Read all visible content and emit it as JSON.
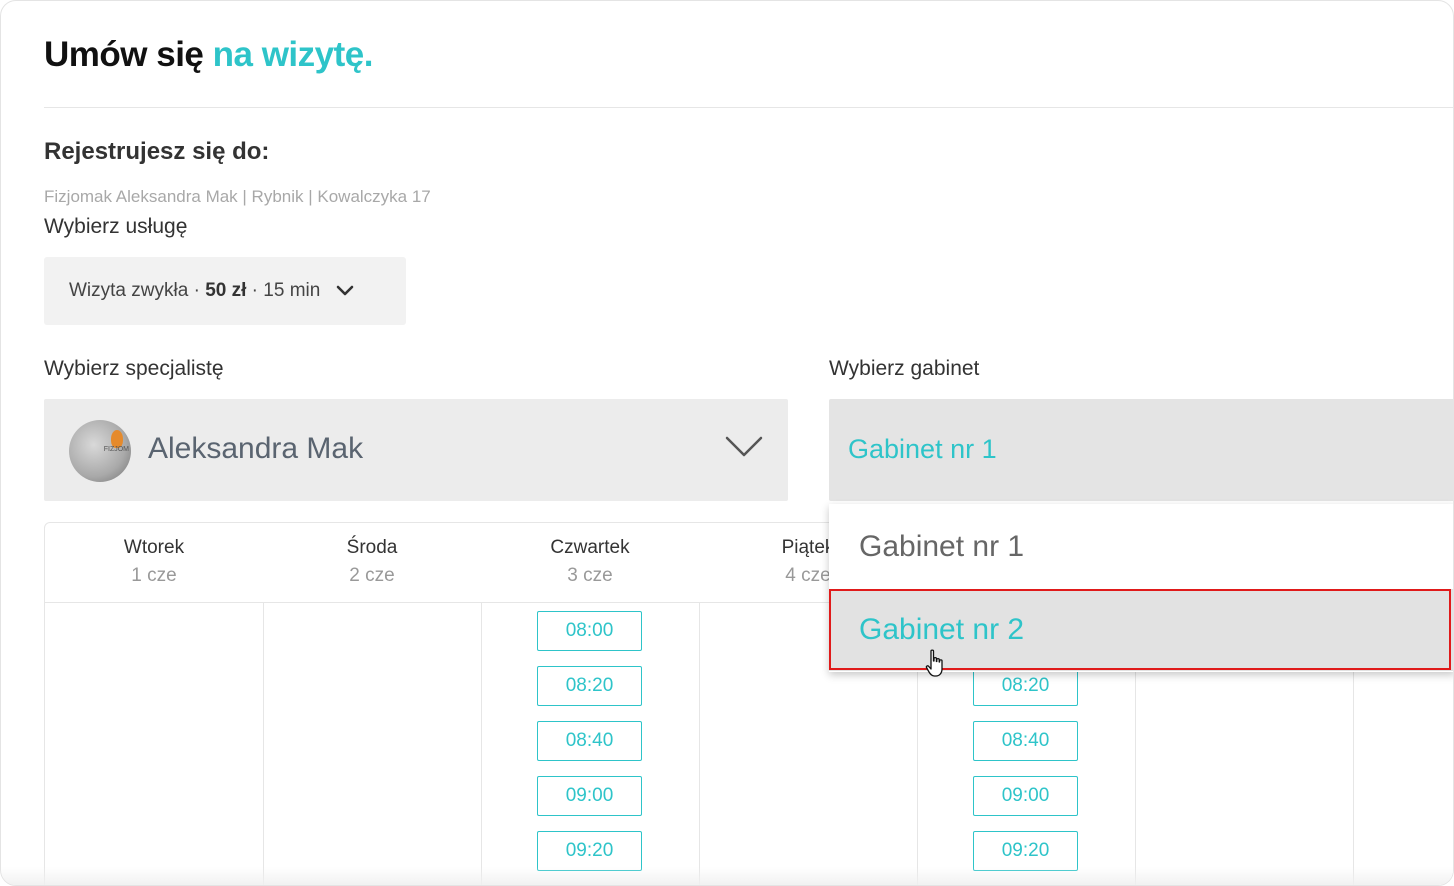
{
  "header": {
    "title_main": "Umów się",
    "title_accent": "na wizytę."
  },
  "registration": {
    "heading": "Rejestrujesz się do:",
    "clinic_info": "Fizjomak Aleksandra Mak | Rybnik | Kowalczyka 17"
  },
  "service": {
    "label": "Wybierz usługę",
    "name": "Wizyta zwykła",
    "price": "50 zł",
    "duration": "15 min",
    "separator": "·"
  },
  "specialist": {
    "label": "Wybierz specjalistę",
    "name": "Aleksandra Mak",
    "avatar_text": "FIZJOM"
  },
  "room": {
    "label": "Wybierz gabinet",
    "selected": "Gabinet nr 1",
    "options": [
      "Gabinet nr 1",
      "Gabinet nr 2"
    ],
    "hovered_option": "Gabinet nr 2"
  },
  "calendar": {
    "days": [
      {
        "name": "Wtorek",
        "date": "1 cze"
      },
      {
        "name": "Środa",
        "date": "2 cze"
      },
      {
        "name": "Czwartek",
        "date": "3 cze"
      },
      {
        "name": "Piątek",
        "date": "4 cze"
      }
    ],
    "col_thursday": [
      "08:00",
      "08:20",
      "08:40",
      "09:00",
      "09:20"
    ],
    "col_fifth": [
      "08:20",
      "08:40",
      "09:00",
      "09:20"
    ]
  },
  "colors": {
    "accent": "#2ec4c9",
    "highlight": "#e01a1a"
  }
}
